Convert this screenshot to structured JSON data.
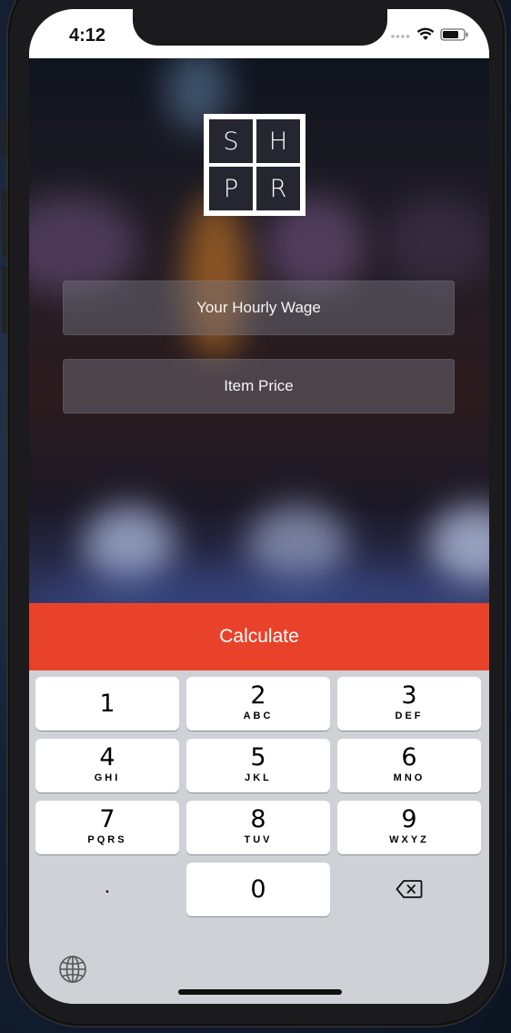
{
  "status_bar": {
    "time": "4:12"
  },
  "logo": {
    "letters": [
      "S",
      "H",
      "P",
      "R"
    ]
  },
  "form": {
    "hourly_wage_placeholder": "Your Hourly Wage",
    "item_price_placeholder": "Item Price"
  },
  "actions": {
    "calculate_label": "Calculate"
  },
  "keypad": {
    "keys": [
      {
        "digit": "1",
        "letters": ""
      },
      {
        "digit": "2",
        "letters": "ABC"
      },
      {
        "digit": "3",
        "letters": "DEF"
      },
      {
        "digit": "4",
        "letters": "GHI"
      },
      {
        "digit": "5",
        "letters": "JKL"
      },
      {
        "digit": "6",
        "letters": "MNO"
      },
      {
        "digit": "7",
        "letters": "PQRS"
      },
      {
        "digit": "8",
        "letters": "TUV"
      },
      {
        "digit": "9",
        "letters": "WXYZ"
      },
      {
        "digit": "0",
        "letters": ""
      }
    ],
    "decimal_label": ".",
    "delete_icon": "backspace-icon",
    "globe_icon": "globe-icon"
  },
  "colors": {
    "accent": "#e8432a",
    "keyboard_bg": "#cfd1d7",
    "key_bg": "#ffffff"
  }
}
